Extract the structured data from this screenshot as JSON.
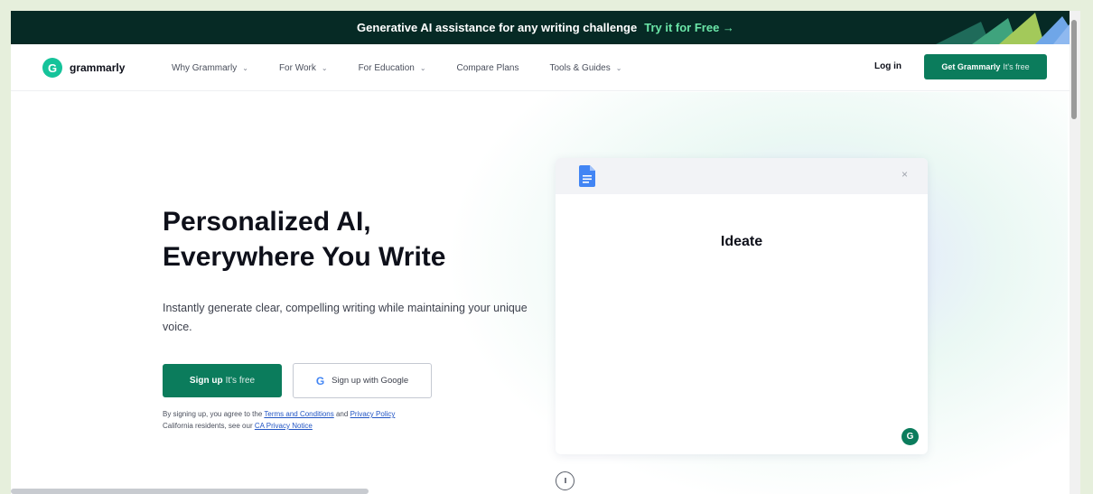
{
  "announcement": {
    "text": "Generative AI assistance for any writing challenge",
    "cta": "Try it for Free →"
  },
  "nav": {
    "logo_text": "grammarly",
    "logo_glyph": "G",
    "items": [
      {
        "label": "Why Grammarly",
        "has_dropdown": true
      },
      {
        "label": "For Work",
        "has_dropdown": true
      },
      {
        "label": "For Education",
        "has_dropdown": true
      },
      {
        "label": "Compare Plans",
        "has_dropdown": false
      },
      {
        "label": "Tools & Guides",
        "has_dropdown": true
      }
    ],
    "login": "Log in",
    "cta": "Get Grammarly",
    "cta_suffix": "It's free"
  },
  "hero": {
    "title_line1": "Personalized AI,",
    "title_line2": "Everywhere You Write",
    "subtitle": "Instantly generate clear, compelling writing while maintaining your unique voice.",
    "signup": "Sign up",
    "signup_suffix": "It's free",
    "google_signup": "Sign up with Google",
    "google_glyph": "G",
    "legal": {
      "prefix": "By signing up, you agree to the",
      "terms": "Terms and Conditions",
      "and": "and",
      "privacy": "Privacy Policy",
      "ca_prefix": "California residents, see our",
      "ca_notice": "CA Privacy Notice"
    }
  },
  "demo_card": {
    "heading": "Ideate",
    "close": "×",
    "badge": "G",
    "pause": "II"
  },
  "icons": {
    "logo": "grammarly-logo-icon",
    "docs": "google-docs-icon",
    "google": "google-g-icon",
    "dropdown": "chevron-down-icon",
    "close": "close-icon",
    "pause": "pause-icon"
  },
  "colors": {
    "brand_green": "#0b7c5c",
    "logo_green": "#15c39a",
    "announce_bg": "#062a25",
    "announce_accent": "#6be6a8",
    "link_blue": "#2255c4"
  }
}
